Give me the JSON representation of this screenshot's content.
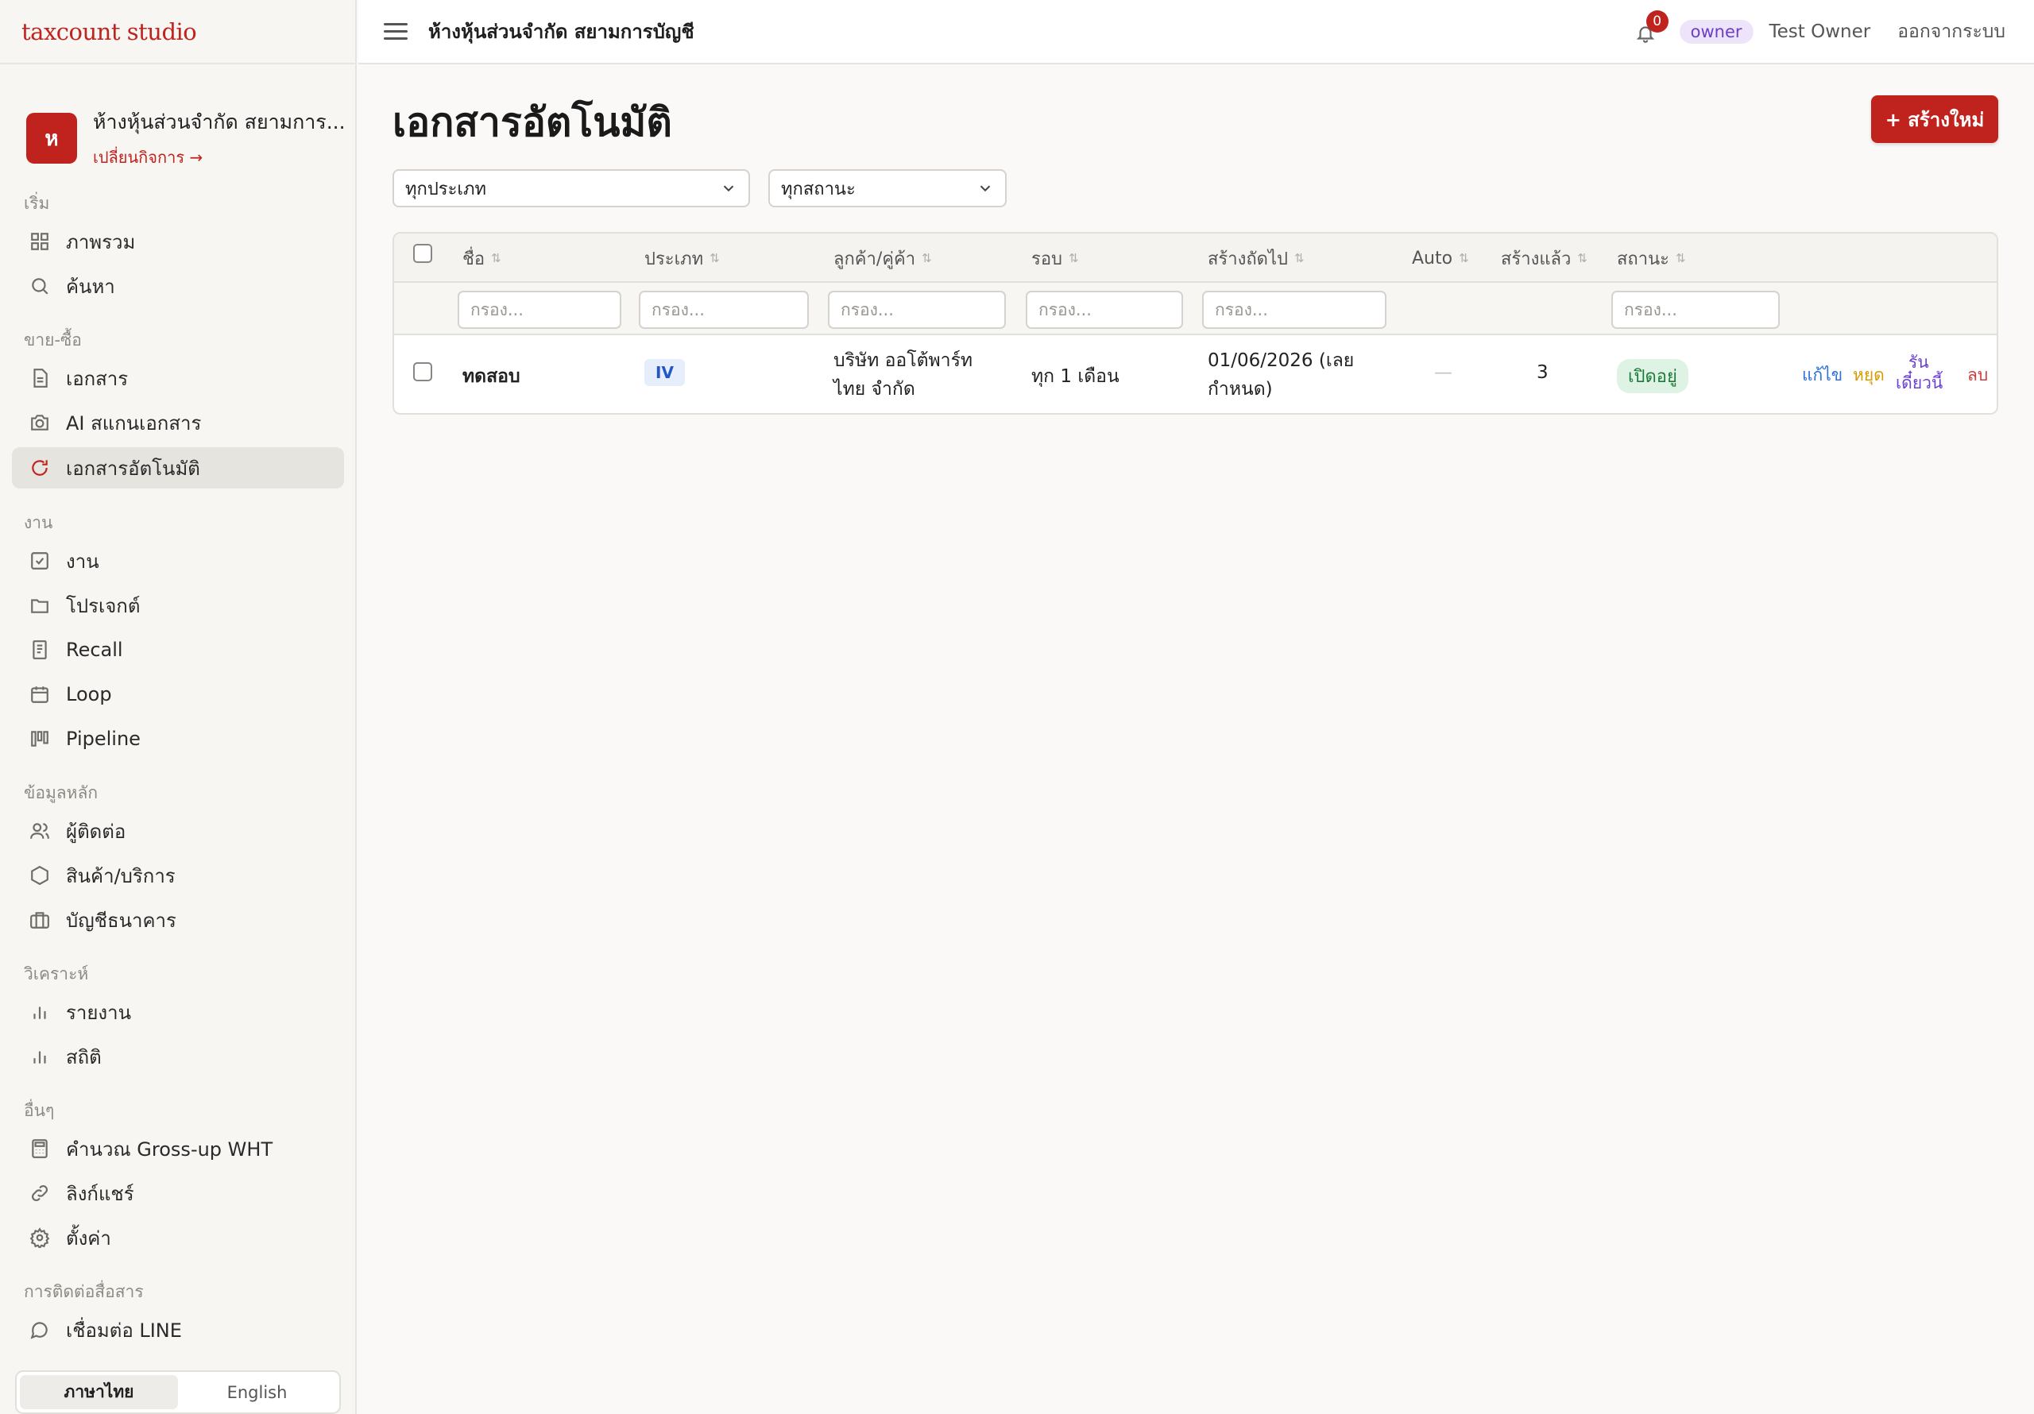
{
  "brand": "taxcount studio",
  "business": {
    "initial": "ห",
    "name": "ห้างหุ้นส่วนจำกัด สยามการ...",
    "switch_label": "เปลี่ยนกิจการ →"
  },
  "sidebar": {
    "sections": [
      {
        "label": "เริ่ม",
        "items": [
          {
            "label": "ภาพรวม",
            "icon": "grid-icon"
          },
          {
            "label": "ค้นหา",
            "icon": "search-icon"
          }
        ]
      },
      {
        "label": "ขาย-ซื้อ",
        "items": [
          {
            "label": "เอกสาร",
            "icon": "document-icon"
          },
          {
            "label": "AI สแกนเอกสาร",
            "icon": "camera-icon"
          },
          {
            "label": "เอกสารอัตโนมัติ",
            "icon": "refresh-icon",
            "active": true
          }
        ]
      },
      {
        "label": "งาน",
        "items": [
          {
            "label": "งาน",
            "icon": "check-square-icon"
          },
          {
            "label": "โปรเจกต์",
            "icon": "folder-icon"
          },
          {
            "label": "Recall",
            "icon": "receipt-icon"
          },
          {
            "label": "Loop",
            "icon": "calendar-icon"
          },
          {
            "label": "Pipeline",
            "icon": "kanban-icon"
          }
        ]
      },
      {
        "label": "ข้อมูลหลัก",
        "items": [
          {
            "label": "ผู้ติดต่อ",
            "icon": "users-icon"
          },
          {
            "label": "สินค้า/บริการ",
            "icon": "box-icon"
          },
          {
            "label": "บัญชีธนาคาร",
            "icon": "briefcase-icon"
          }
        ]
      },
      {
        "label": "วิเคราะห์",
        "items": [
          {
            "label": "รายงาน",
            "icon": "bar-chart-icon"
          },
          {
            "label": "สถิติ",
            "icon": "bar-chart-icon"
          }
        ]
      },
      {
        "label": "อื่นๆ",
        "items": [
          {
            "label": "คำนวณ Gross-up WHT",
            "icon": "calculator-icon"
          },
          {
            "label": "ลิงก์แชร์",
            "icon": "link-icon"
          },
          {
            "label": "ตั้งค่า",
            "icon": "gear-icon"
          }
        ]
      },
      {
        "label": "การติดต่อสื่อสาร",
        "items": [
          {
            "label": "เชื่อมต่อ LINE",
            "icon": "chat-icon"
          }
        ]
      }
    ],
    "languages": [
      {
        "label": "ภาษาไทย",
        "active": true
      },
      {
        "label": "English",
        "active": false
      }
    ]
  },
  "topbar": {
    "title": "ห้างหุ้นส่วนจำกัด สยามการบัญชี",
    "notification_count": "0",
    "role": "owner",
    "user": "Test Owner",
    "logout": "ออกจากระบบ"
  },
  "page": {
    "title": "เอกสารอัตโนมัติ",
    "create_button": "+ สร้างใหม่",
    "type_filter": "ทุกประเภท",
    "status_filter": "ทุกสถานะ"
  },
  "table": {
    "columns": [
      "ชื่อ",
      "ประเภท",
      "ลูกค้า/คู่ค้า",
      "รอบ",
      "สร้างถัดไป",
      "Auto",
      "สร้างแล้ว",
      "สถานะ"
    ],
    "filter_placeholder": "กรอง...",
    "rows": [
      {
        "name": "ทดสอบ",
        "type": "IV",
        "customer_line1": "บริษัท ออโต้พาร์ท",
        "customer_line2": "ไทย จำกัด",
        "cycle": "ทุก 1 เดือน",
        "next_line1": "01/06/2026 (เลย",
        "next_line2": "กำหนด)",
        "auto": "—",
        "created": "3",
        "status": "เปิดอยู่",
        "actions": {
          "edit": "แก้ไข",
          "pause": "หยุด",
          "run_line1": "รัน",
          "run_line2": "เดี๋ยวนี้",
          "delete": "ลบ"
        }
      }
    ]
  },
  "colors": {
    "accent": "#c0231d",
    "edit": "#2f6fde",
    "pause": "#d99a00",
    "run": "#6b3fd4",
    "delete": "#d23b3b"
  }
}
